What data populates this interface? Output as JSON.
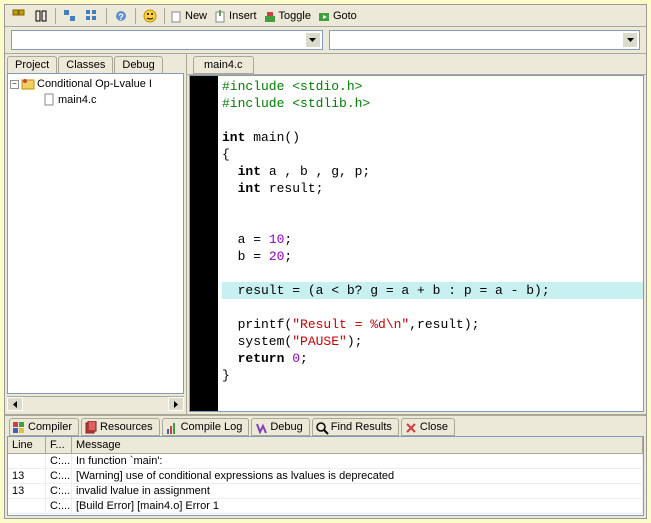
{
  "toolbar": {
    "new": "New",
    "insert": "Insert",
    "toggle": "Toggle",
    "goto": "Goto"
  },
  "combo1": {
    "value": ""
  },
  "combo2": {
    "value": ""
  },
  "leftTabs": [
    "Project",
    "Classes",
    "Debug"
  ],
  "tree": {
    "root": "Conditional Op-Lvalue I",
    "child": "main4.c"
  },
  "fileTab": "main4.c",
  "code": {
    "l1a": "#include ",
    "l1b": "<stdio.h>",
    "l2a": "#include ",
    "l2b": "<stdlib.h>",
    "l3": "",
    "l4a": "int",
    "l4b": " main()",
    "l5": "{",
    "l6a": "  int",
    "l6b": " a , b , g, p;",
    "l7a": "  int",
    "l7b": " result;",
    "l8": "",
    "l9": "",
    "l10a": "  a = ",
    "l10b": "10",
    "l10c": ";",
    "l11a": "  b = ",
    "l11b": "20",
    "l11c": ";",
    "l12": "",
    "l13": "  result = (a < b? g = a + b : p = a - b);",
    "l14": "",
    "l15a": "  printf(",
    "l15b": "\"Result = %d\\n\"",
    "l15c": ",result);",
    "l16a": "  system(",
    "l16b": "\"PAUSE\"",
    "l16c": ");",
    "l17a": "  return ",
    "l17b": "0",
    "l17c": ";",
    "l18": "}"
  },
  "bottomTabs": [
    "Compiler",
    "Resources",
    "Compile Log",
    "Debug",
    "Find Results",
    "Close"
  ],
  "grid": {
    "headers": {
      "line": "Line",
      "file": "F...",
      "msg": "Message"
    },
    "rows": [
      {
        "line": "",
        "file": "C:...",
        "msg": "In function `main':"
      },
      {
        "line": "13",
        "file": "C:...",
        "msg": "[Warning] use of conditional expressions as lvalues is deprecated"
      },
      {
        "line": "13",
        "file": "C:...",
        "msg": " invalid lvalue in assignment"
      },
      {
        "line": "",
        "file": "C:...",
        "msg": "[Build Error]  [main4.o] Error 1"
      }
    ]
  },
  "chart_data": null
}
